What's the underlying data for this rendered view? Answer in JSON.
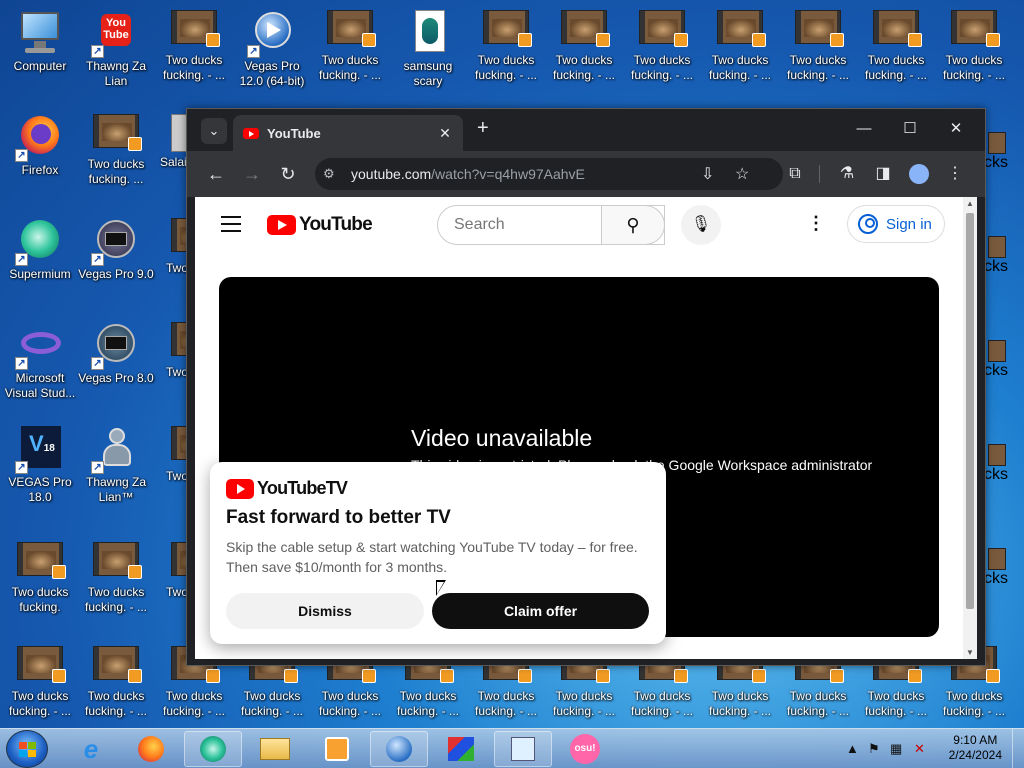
{
  "desktop": {
    "icons_row1": [
      {
        "label": "Computer",
        "icon": "computer-icon"
      },
      {
        "label": "Thawng Za Lian",
        "icon": "youtube-icon"
      },
      {
        "label": "Two ducks fucking. - ...",
        "icon": "video-icon"
      },
      {
        "label": "Vegas Pro 12.0 (64-bit)",
        "icon": "vegas-icon"
      },
      {
        "label": "Two ducks fucking. - ...",
        "icon": "video-icon"
      },
      {
        "label": "samsung scary",
        "icon": "document-icon"
      },
      {
        "label": "Two ducks fucking. - ...",
        "icon": "video-icon"
      },
      {
        "label": "Two ducks fucking. - ...",
        "icon": "video-icon"
      },
      {
        "label": "Two ducks fucking. - ...",
        "icon": "video-icon"
      },
      {
        "label": "Two ducks fucking. - ...",
        "icon": "video-icon"
      },
      {
        "label": "Two ducks fucking. - ...",
        "icon": "video-icon"
      },
      {
        "label": "Two ducks fucking. - ...",
        "icon": "video-icon"
      },
      {
        "label": "Two ducks fucking. - ...",
        "icon": "video-icon"
      }
    ],
    "icons_col1": [
      {
        "label": "Firefox",
        "icon": "firefox-icon"
      },
      {
        "label": "Supermium",
        "icon": "supermium-icon"
      },
      {
        "label": "Microsoft Visual Stud...",
        "icon": "visual-studio-icon"
      },
      {
        "label": "VEGAS Pro 18.0",
        "icon": "vegas18-icon"
      },
      {
        "label": "Two ducks fucking.",
        "icon": "video-icon"
      },
      {
        "label": "Two ducks fucking. - ...",
        "icon": "video-icon"
      }
    ],
    "icons_col2": [
      {
        "label": "Two ducks fucking. ...",
        "icon": "video-icon"
      },
      {
        "label": "Vegas Pro 9.0",
        "icon": "vegas-icon"
      },
      {
        "label": "Vegas Pro 8.0",
        "icon": "vegas-icon"
      },
      {
        "label": "Thawng Za Lian™",
        "icon": "person-icon"
      },
      {
        "label": "Two ducks fucking. - ...",
        "icon": "video-icon"
      },
      {
        "label": "Two ducks fucking. - ...",
        "icon": "video-icon"
      }
    ],
    "icon_col3_partial": [
      "Salai Za",
      "Two fuck",
      "Two fuck",
      "Two fuck",
      "Two fuck"
    ],
    "icons_bottom_row": [
      "Two ducks fucking. - ...",
      "Two ducks fucking. - ...",
      "Two ducks fucking. - ...",
      "Two ducks fucking. - ...",
      "Two ducks fucking. - ...",
      "Two ducks fucking. - ...",
      "Two ducks fucking. - ...",
      "Two ducks fucking. - ...",
      "Two ducks fucking. - ...",
      "Two ducks fucking. - ..."
    ],
    "right_partial": [
      "cks",
      "cks",
      "cks",
      "cks",
      "cks",
      "cks"
    ]
  },
  "browser": {
    "tab_title": "YouTube",
    "tab_close": "✕",
    "new_tab": "+",
    "url_host": "youtube.com",
    "url_path": "/watch?v=q4hw97AahvE",
    "win_min": "—",
    "win_max": "☐",
    "win_close": "✕"
  },
  "youtube": {
    "logo_text": "YouTube",
    "search_placeholder": "Search",
    "sign_in": "Sign in",
    "video_title": "Video unavailable",
    "video_message": "This video is restricted. Please check the Google Workspace administrator ...tions."
  },
  "promo": {
    "logo_text": "YouTubeTV",
    "title": "Fast forward to better TV",
    "body": "Skip the cable setup & start watching YouTube TV today – for free. Then save $10/month for 3 months.",
    "dismiss": "Dismiss",
    "claim": "Claim offer"
  },
  "taskbar": {
    "time": "9:10 AM",
    "date": "2/24/2024",
    "apps": [
      "internet-explorer-icon",
      "firefox-icon",
      "supermium-icon",
      "file-explorer-icon",
      "media-player-icon",
      "vegas-icon",
      "paint-icon",
      "notepad-icon",
      "osu-icon"
    ],
    "osu_label": "osu!"
  },
  "colors": {
    "youtube_red": "#ff0000",
    "link_blue": "#065fd4",
    "chrome_dark": "#202124"
  }
}
